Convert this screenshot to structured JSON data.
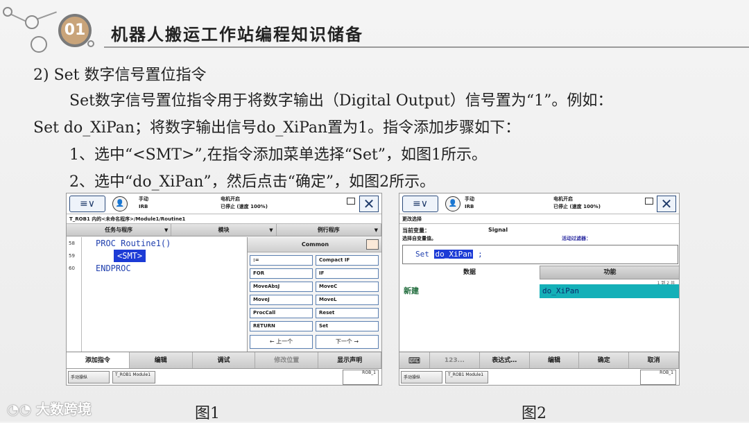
{
  "header": {
    "section_number": "01",
    "title": "机器人搬运工作站编程知识储备"
  },
  "body": {
    "heading": "2) Set 数字信号置位指令",
    "line1": "Set数字信号置位指令用于将数字输出（Digital Output）信号置为“1”。例如：",
    "line2": "Set do_XiPan；将数字输出信号do_XiPan置为1。指令添加步骤如下：",
    "step1": "1、选中“<SMT>”,在指令添加菜单选择“Set”，如图1所示。",
    "step2": "2、选中“do_XiPan”，然后点击“确定”，如图2所示。"
  },
  "fig1": {
    "caption": "图1",
    "menu_icon": "≡∨",
    "mode": "手动",
    "device": "IRB",
    "motor": "电机开启",
    "speed": "已停止 (速度 100%)",
    "breadcrumb": "T_ROB1 内的<未命名程序>/Module1/Routine1",
    "tabs": [
      "任务与程序",
      "模块",
      "例行程序"
    ],
    "line_numbers": [
      "58",
      "59",
      "60"
    ],
    "code": [
      "PROC Routine1()",
      "<SMT>",
      "ENDPROC"
    ],
    "panel_title": "Common",
    "instructions": [
      ":=",
      "Compact IF",
      "FOR",
      "IF",
      "MoveAbsJ",
      "MoveC",
      "MoveJ",
      "MoveL",
      "ProcCall",
      "Reset",
      "RETURN",
      "Set"
    ],
    "prev": "←  上一个",
    "next": "下一个 →",
    "bottom": [
      "添加指令",
      "编辑",
      "调试",
      "修改位置",
      "显示声明"
    ],
    "status_btn1": "手动操纵",
    "status_btn2": "T_ROB1 Module1",
    "rob": "ROB_1"
  },
  "fig2": {
    "caption": "图2",
    "menu_icon": "≡∨",
    "mode": "手动",
    "device": "IRB",
    "motor": "电机开启",
    "speed": "已停止 (速度 100%)",
    "breadcrumb": "更改选择",
    "current_var_label": "当前变量：",
    "current_var_value": "Signal",
    "select_label": "选择自变量值。",
    "filter_label": "活动过滤器：",
    "expr_prefix": "Set",
    "expr_value": "do_XiPan",
    "expr_suffix": ";",
    "tab_data": "数据",
    "tab_func": "功能",
    "page_indicator": "1 到 2 共",
    "new_label": "新建",
    "item": "do_XiPan",
    "bottom": [
      "123...",
      "表达式…",
      "编辑",
      "确定",
      "取消"
    ],
    "status_btn1": "手动操纵",
    "status_btn2": "T_ROB1 Module1",
    "rob": "ROB_1"
  },
  "watermark": "大数跨境"
}
